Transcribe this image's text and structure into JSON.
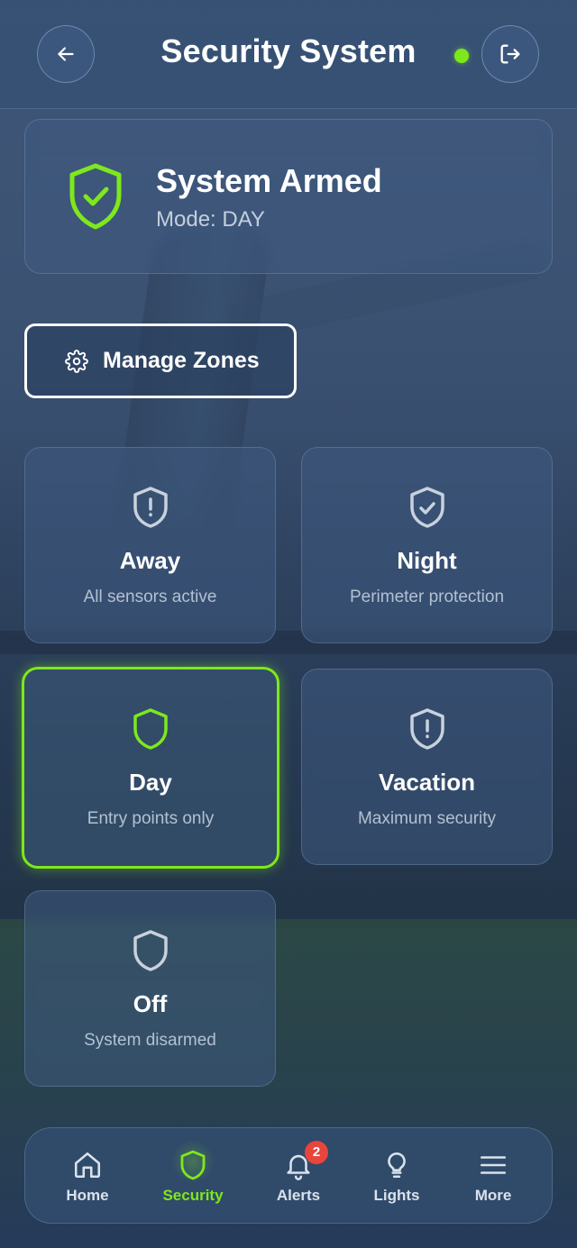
{
  "header": {
    "title": "Security System",
    "back_icon": "arrow-left-icon",
    "logout_icon": "logout-icon",
    "status_color": "#7ee81c"
  },
  "status_card": {
    "title": "System Armed",
    "mode_text": "Mode: DAY",
    "icon": "shield-check-icon"
  },
  "manage_zones": {
    "label": "Manage Zones",
    "icon": "gear-icon"
  },
  "modes": [
    {
      "name": "Away",
      "description": "All sensors active",
      "icon": "shield-alert-icon",
      "selected": false
    },
    {
      "name": "Night",
      "description": "Perimeter protection",
      "icon": "shield-check-icon",
      "selected": false
    },
    {
      "name": "Day",
      "description": "Entry points only",
      "icon": "shield-icon",
      "selected": true
    },
    {
      "name": "Vacation",
      "description": "Maximum security",
      "icon": "shield-alert-icon",
      "selected": false
    },
    {
      "name": "Off",
      "description": "System disarmed",
      "icon": "shield-icon",
      "selected": false
    }
  ],
  "bottom_nav": [
    {
      "label": "Home",
      "icon": "home-icon",
      "active": false
    },
    {
      "label": "Security",
      "icon": "shield-icon",
      "active": true
    },
    {
      "label": "Alerts",
      "icon": "bell-icon",
      "active": false,
      "badge": "2"
    },
    {
      "label": "Lights",
      "icon": "lightbulb-icon",
      "active": false
    },
    {
      "label": "More",
      "icon": "menu-icon",
      "active": false
    }
  ],
  "colors": {
    "accent": "#7ee81c",
    "badge": "#e8453c"
  }
}
